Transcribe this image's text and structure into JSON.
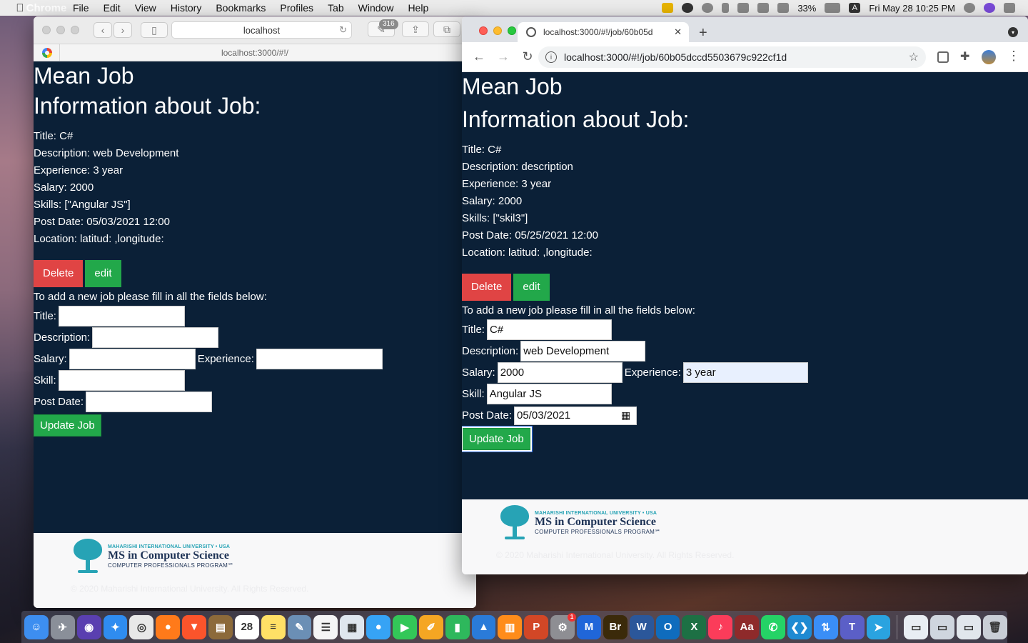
{
  "menubar": {
    "app": "Chrome",
    "items": [
      "File",
      "Edit",
      "View",
      "History",
      "Bookmarks",
      "Profiles",
      "Tab",
      "Window",
      "Help"
    ],
    "battery": "33%",
    "user_initial": "A",
    "datetime": "Fri May 28  10:25 PM"
  },
  "safari": {
    "url": "localhost",
    "tab_url": "localhost:3000/#!/",
    "badge": "316"
  },
  "chrome": {
    "tab_title": "localhost:3000/#!/job/60b05d",
    "url": "localhost:3000/#!/job/60b05dccd5503679c922cf1d"
  },
  "left_page": {
    "title": "Mean Job",
    "subtitle": "Information about Job:",
    "info": [
      "Title: C#",
      "Description: web Development",
      "Experience: 3 year",
      "Salary: 2000",
      "Skills: [\"Angular JS\"]",
      "Post Date: 05/03/2021 12:00",
      "Location: latitud: ,longitude:"
    ],
    "delete_label": "Delete",
    "edit_label": "edit",
    "form_lead": "To add a new job please fill in all the fields below:",
    "labels": {
      "title": "Title:",
      "description": "Description:",
      "salary": "Salary:",
      "experience": "Experience:",
      "skill": "Skill:",
      "post_date": "Post Date:"
    },
    "values": {
      "title": "",
      "description": "",
      "salary": "",
      "experience": "",
      "skill": "",
      "post_date": ""
    },
    "update_label": "Update Job"
  },
  "right_page": {
    "title": "Mean Job",
    "subtitle": "Information about Job:",
    "info": [
      "Title: C#",
      "Description: description",
      "Experience: 3 year",
      "Salary: 2000",
      "Skills: [\"skil3\"]",
      "Post Date: 05/25/2021 12:00",
      "Location: latitud: ,longitude:"
    ],
    "delete_label": "Delete",
    "edit_label": "edit",
    "form_lead": "To add a new job please fill in all the fields below:",
    "labels": {
      "title": "Title:",
      "description": "Description:",
      "salary": "Salary:",
      "experience": "Experience:",
      "skill": "Skill:",
      "post_date": "Post Date:"
    },
    "values": {
      "title": "C#",
      "description": "web Development",
      "salary": "2000",
      "experience": "3 year",
      "skill": "Angular JS",
      "post_date": "05/03/2021"
    },
    "update_label": "Update Job"
  },
  "footer": {
    "uni_small": "MAHARISHI INTERNATIONAL UNIVERSITY • USA",
    "program": "MS in Computer Science",
    "cpp": "COMPUTER PROFESSIONALS PROGRAM℠",
    "copyright": "© 2020 Maharishi International University. All Rights Reserved."
  },
  "dock": {
    "apps": [
      {
        "name": "finder-icon",
        "color": "#3d8ef0",
        "glyph": "☺"
      },
      {
        "name": "launchpad-icon",
        "color": "#8a8f99",
        "glyph": "✈"
      },
      {
        "name": "siri-icon",
        "color": "#5a3fb0",
        "glyph": "◉"
      },
      {
        "name": "safari-icon",
        "color": "#2f8cf0",
        "glyph": "✦"
      },
      {
        "name": "chrome-icon",
        "color": "#e8e8e8",
        "glyph": "◎"
      },
      {
        "name": "firefox-icon",
        "color": "#ff7a1a",
        "glyph": "●"
      },
      {
        "name": "brave-icon",
        "color": "#fb542b",
        "glyph": "▼"
      },
      {
        "name": "notes-brown-icon",
        "color": "#8c6a3a",
        "glyph": "▤"
      },
      {
        "name": "calendar-icon",
        "color": "#ffffff",
        "glyph": "28"
      },
      {
        "name": "notes-icon",
        "color": "#ffe066",
        "glyph": "≡"
      },
      {
        "name": "preview-icon",
        "color": "#6b8fb5",
        "glyph": "✎"
      },
      {
        "name": "reminders-icon",
        "color": "#f5f5f5",
        "glyph": "☰"
      },
      {
        "name": "photos-icon",
        "color": "#dfe6ee",
        "glyph": "▦"
      },
      {
        "name": "messages-icon",
        "color": "#36a3f5",
        "glyph": "●"
      },
      {
        "name": "facetime-icon",
        "color": "#33c758",
        "glyph": "▶"
      },
      {
        "name": "pages-icon",
        "color": "#f5a623",
        "glyph": "✐"
      },
      {
        "name": "numbers-icon",
        "color": "#2eb85c",
        "glyph": "▮"
      },
      {
        "name": "keynote-icon",
        "color": "#2a7bd9",
        "glyph": "▲"
      },
      {
        "name": "books-icon",
        "color": "#ff8c1a",
        "glyph": "▥"
      },
      {
        "name": "powerpoint-icon",
        "color": "#d24726",
        "glyph": "P"
      },
      {
        "name": "system-preferences-icon",
        "color": "#8e8e93",
        "glyph": "⚙"
      },
      {
        "name": "malwarebytes-icon",
        "color": "#2066d9",
        "glyph": "M"
      },
      {
        "name": "bridge-icon",
        "color": "#3b2a0a",
        "glyph": "Br"
      },
      {
        "name": "word-icon",
        "color": "#2b579a",
        "glyph": "W"
      },
      {
        "name": "outlook-icon",
        "color": "#0f6cbd",
        "glyph": "O"
      },
      {
        "name": "excel-icon",
        "color": "#1d7044",
        "glyph": "X"
      },
      {
        "name": "music-icon",
        "color": "#fb3c5a",
        "glyph": "♪"
      },
      {
        "name": "dictionary-icon",
        "color": "#8e2a2a",
        "glyph": "Aa"
      },
      {
        "name": "whatsapp-icon",
        "color": "#25d366",
        "glyph": "✆"
      },
      {
        "name": "vscode-icon",
        "color": "#1f8ad2",
        "glyph": "❮❯"
      },
      {
        "name": "transmit-icon",
        "color": "#3a8ef6",
        "glyph": "⇅"
      },
      {
        "name": "teams-icon",
        "color": "#5b5fc7",
        "glyph": "T"
      },
      {
        "name": "telegram-icon",
        "color": "#2aa3e0",
        "glyph": "➤"
      }
    ],
    "right": [
      {
        "name": "downloads-folder-icon",
        "color": "#e8edf3",
        "glyph": "▭"
      },
      {
        "name": "window-preview-icon",
        "color": "#cfd6df",
        "glyph": "▭"
      },
      {
        "name": "window-preview-2-icon",
        "color": "#e1e6ec",
        "glyph": "▭"
      },
      {
        "name": "trash-icon",
        "color": "#c9ced6",
        "glyph": "🗑"
      }
    ],
    "badge_system_preferences": "1"
  }
}
